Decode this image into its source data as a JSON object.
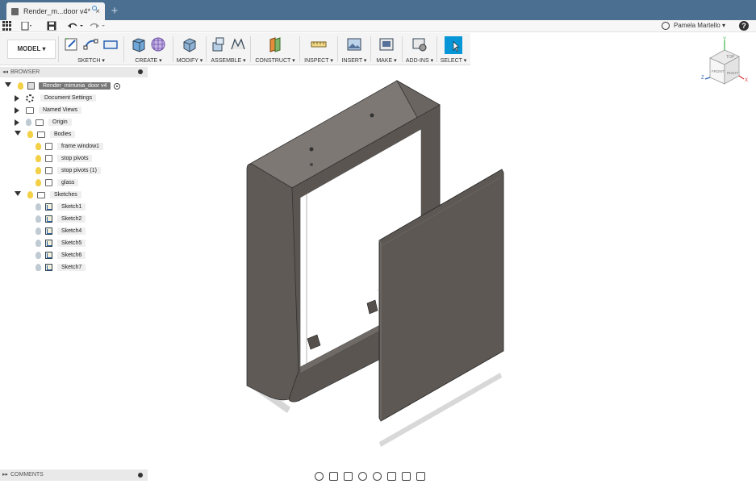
{
  "tab": {
    "title": "Render_m...door v4*",
    "close": "×",
    "new_tab": "+"
  },
  "user": {
    "name": "Pamela Martello ▾",
    "help": "?"
  },
  "ribbon": {
    "mode": "MODEL ▾",
    "groups": [
      {
        "label": "SKETCH ▾"
      },
      {
        "label": "CREATE ▾"
      },
      {
        "label": "MODIFY ▾"
      },
      {
        "label": "ASSEMBLE ▾"
      },
      {
        "label": "CONSTRUCT ▾"
      },
      {
        "label": "INSPECT ▾"
      },
      {
        "label": "INSERT ▾"
      },
      {
        "label": "MAKE ▾"
      },
      {
        "label": "ADD-INS ▾"
      },
      {
        "label": "SELECT ▾"
      }
    ]
  },
  "browser": {
    "title": "BROWSER",
    "root": "Render_mirrunia_door v4",
    "items": [
      {
        "label": "Document Settings"
      },
      {
        "label": "Named Views"
      },
      {
        "label": "Origin"
      },
      {
        "label": "Bodies"
      },
      {
        "label": "frame window1"
      },
      {
        "label": "stop pivots"
      },
      {
        "label": "stop pivots (1)"
      },
      {
        "label": "glass"
      },
      {
        "label": "Sketches"
      },
      {
        "label": "Sketch1"
      },
      {
        "label": "Sketch2"
      },
      {
        "label": "Sketch4"
      },
      {
        "label": "Sketch5"
      },
      {
        "label": "Sketch6"
      },
      {
        "label": "Sketch7"
      }
    ]
  },
  "comments": {
    "title": "COMMENTS"
  },
  "viewcube": {
    "top": "TOP",
    "front": "FRONT",
    "right": "RIGHT",
    "x": "X",
    "y": "Y",
    "z": "Z"
  },
  "colors": {
    "titlebar": "#4a6f91",
    "accent": "#0696d7",
    "frame": "#5f5a55"
  }
}
